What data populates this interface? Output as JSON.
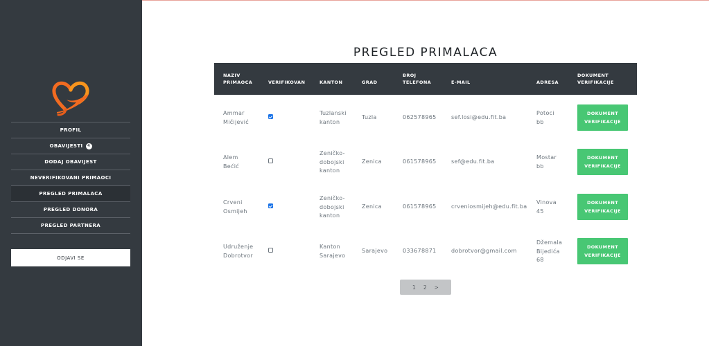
{
  "sidebar": {
    "logo": "heart-hand-icon",
    "items": [
      {
        "label": "PROFIL",
        "active": false
      },
      {
        "label": "OBAVIJESTI",
        "badge": "4",
        "active": false
      },
      {
        "label": "DODAJ OBAVIJEST",
        "active": false
      },
      {
        "label": "NEVERIFIKOVANI PRIMAOCI",
        "active": false
      },
      {
        "label": "PREGLED PRIMALACA",
        "active": true
      },
      {
        "label": "PREGLED DONORA",
        "active": false
      },
      {
        "label": "PREGLED PARTNERA",
        "active": false
      }
    ],
    "logout_label": "ODJAVI SE"
  },
  "main": {
    "title": "PREGLED PRIMALACA",
    "table": {
      "headers": [
        [
          "NAZIV",
          "PRIMAOCA"
        ],
        [
          "VERIFIKOVAN"
        ],
        [
          "KANTON"
        ],
        [
          "GRAD"
        ],
        [
          "BROJ",
          "TELEFONA"
        ],
        [
          "E-MAIL"
        ],
        [
          "ADRESA"
        ],
        [
          "DOKUMENT",
          "VERIFIKACIJE"
        ]
      ],
      "rows": [
        {
          "name": [
            "Ammar",
            "Mičijević"
          ],
          "verified": true,
          "canton": [
            "Tuzlanski",
            "kanton"
          ],
          "city": "Tuzla",
          "phone": "062578965",
          "email": "sef.losi@edu.fit.ba",
          "address": [
            "Potoci",
            "bb"
          ],
          "doc": [
            "DOKUMENT",
            "VERIFIKACIJE"
          ]
        },
        {
          "name": [
            "Alem",
            "Bećić"
          ],
          "verified": false,
          "canton": [
            "Zeničko-",
            "dobojski",
            "kanton"
          ],
          "city": "Zenica",
          "phone": "061578965",
          "email": "sef@edu.fit.ba",
          "address": [
            "Mostar",
            "bb"
          ],
          "doc": [
            "DOKUMENT",
            "VERIFIKACIJE"
          ]
        },
        {
          "name": [
            "Crveni",
            "Osmijeh"
          ],
          "verified": true,
          "canton": [
            "Zeničko-",
            "dobojski",
            "kanton"
          ],
          "city": "Zenica",
          "phone": "061578965",
          "email": "crveniosmijeh@edu.fit.ba",
          "address": [
            "Vinova",
            "45"
          ],
          "doc": [
            "DOKUMENT",
            "VERIFIKACIJE"
          ]
        },
        {
          "name": [
            "Udruženje",
            "Dobrotvor"
          ],
          "verified": false,
          "canton": [
            "Kanton",
            "Sarajevo"
          ],
          "city": "Sarajevo",
          "phone": "033678871",
          "email": "dobrotvor@gmail.com",
          "address": [
            "Džemala",
            "Bijedića",
            "68"
          ],
          "doc": [
            "DOKUMENT",
            "VERIFIKACIJE"
          ]
        }
      ]
    },
    "pagination": [
      "1",
      "2",
      ">"
    ]
  },
  "colors": {
    "sidebar_bg": "#343a40",
    "header_bg": "#343a40",
    "button_green": "#48c774",
    "checkbox_blue": "#1a73e8",
    "logo_orange": "#f26b21"
  }
}
